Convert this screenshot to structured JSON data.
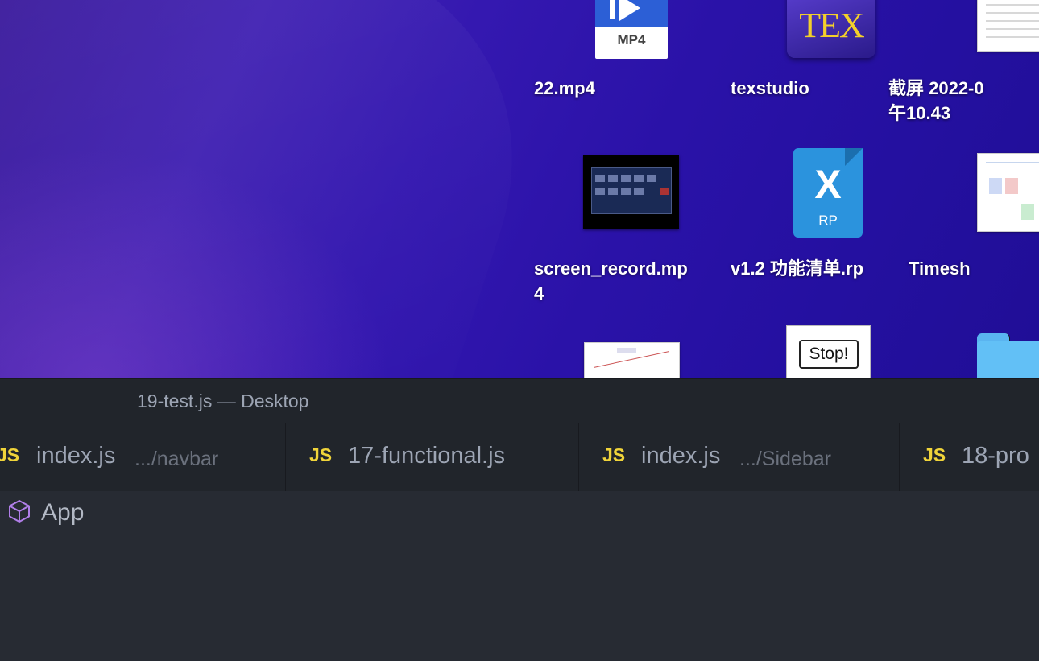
{
  "desktop": {
    "icons": [
      {
        "label": "22.mp4",
        "badge": "MP4",
        "type": "video"
      },
      {
        "label": "texstudio",
        "badge": "TEX",
        "type": "app"
      },
      {
        "label": "截屏 2022-0\n午10.43",
        "type": "screenshot"
      },
      {
        "label": "screen_record.mp\n4",
        "type": "video"
      },
      {
        "label": "v1.2 功能清单.rp",
        "badge": "RP",
        "type": "axure"
      },
      {
        "label": "Timesh",
        "type": "spreadsheet"
      },
      {
        "label": "",
        "type": "image"
      },
      {
        "label": "",
        "badge": "Stop!",
        "type": "image"
      },
      {
        "label": "",
        "type": "folder"
      }
    ]
  },
  "editor": {
    "window_title": "19-test.js — Desktop",
    "tabs": [
      {
        "icon": "JS",
        "name": "index.js",
        "path": ".../navbar"
      },
      {
        "icon": "JS",
        "name": "17-functional.js",
        "path": ""
      },
      {
        "icon": "JS",
        "name": "index.js",
        "path": ".../Sidebar"
      },
      {
        "icon": "JS",
        "name": "18-pro",
        "path": ""
      }
    ],
    "breadcrumb": {
      "icon": "cube-icon",
      "label": "App"
    }
  },
  "colors": {
    "desktop_bg": "#2a12a8",
    "editor_bg": "#272b33",
    "tab_bg": "#21252b",
    "js_icon": "#f0d43a",
    "cube_icon": "#b07ee8"
  }
}
